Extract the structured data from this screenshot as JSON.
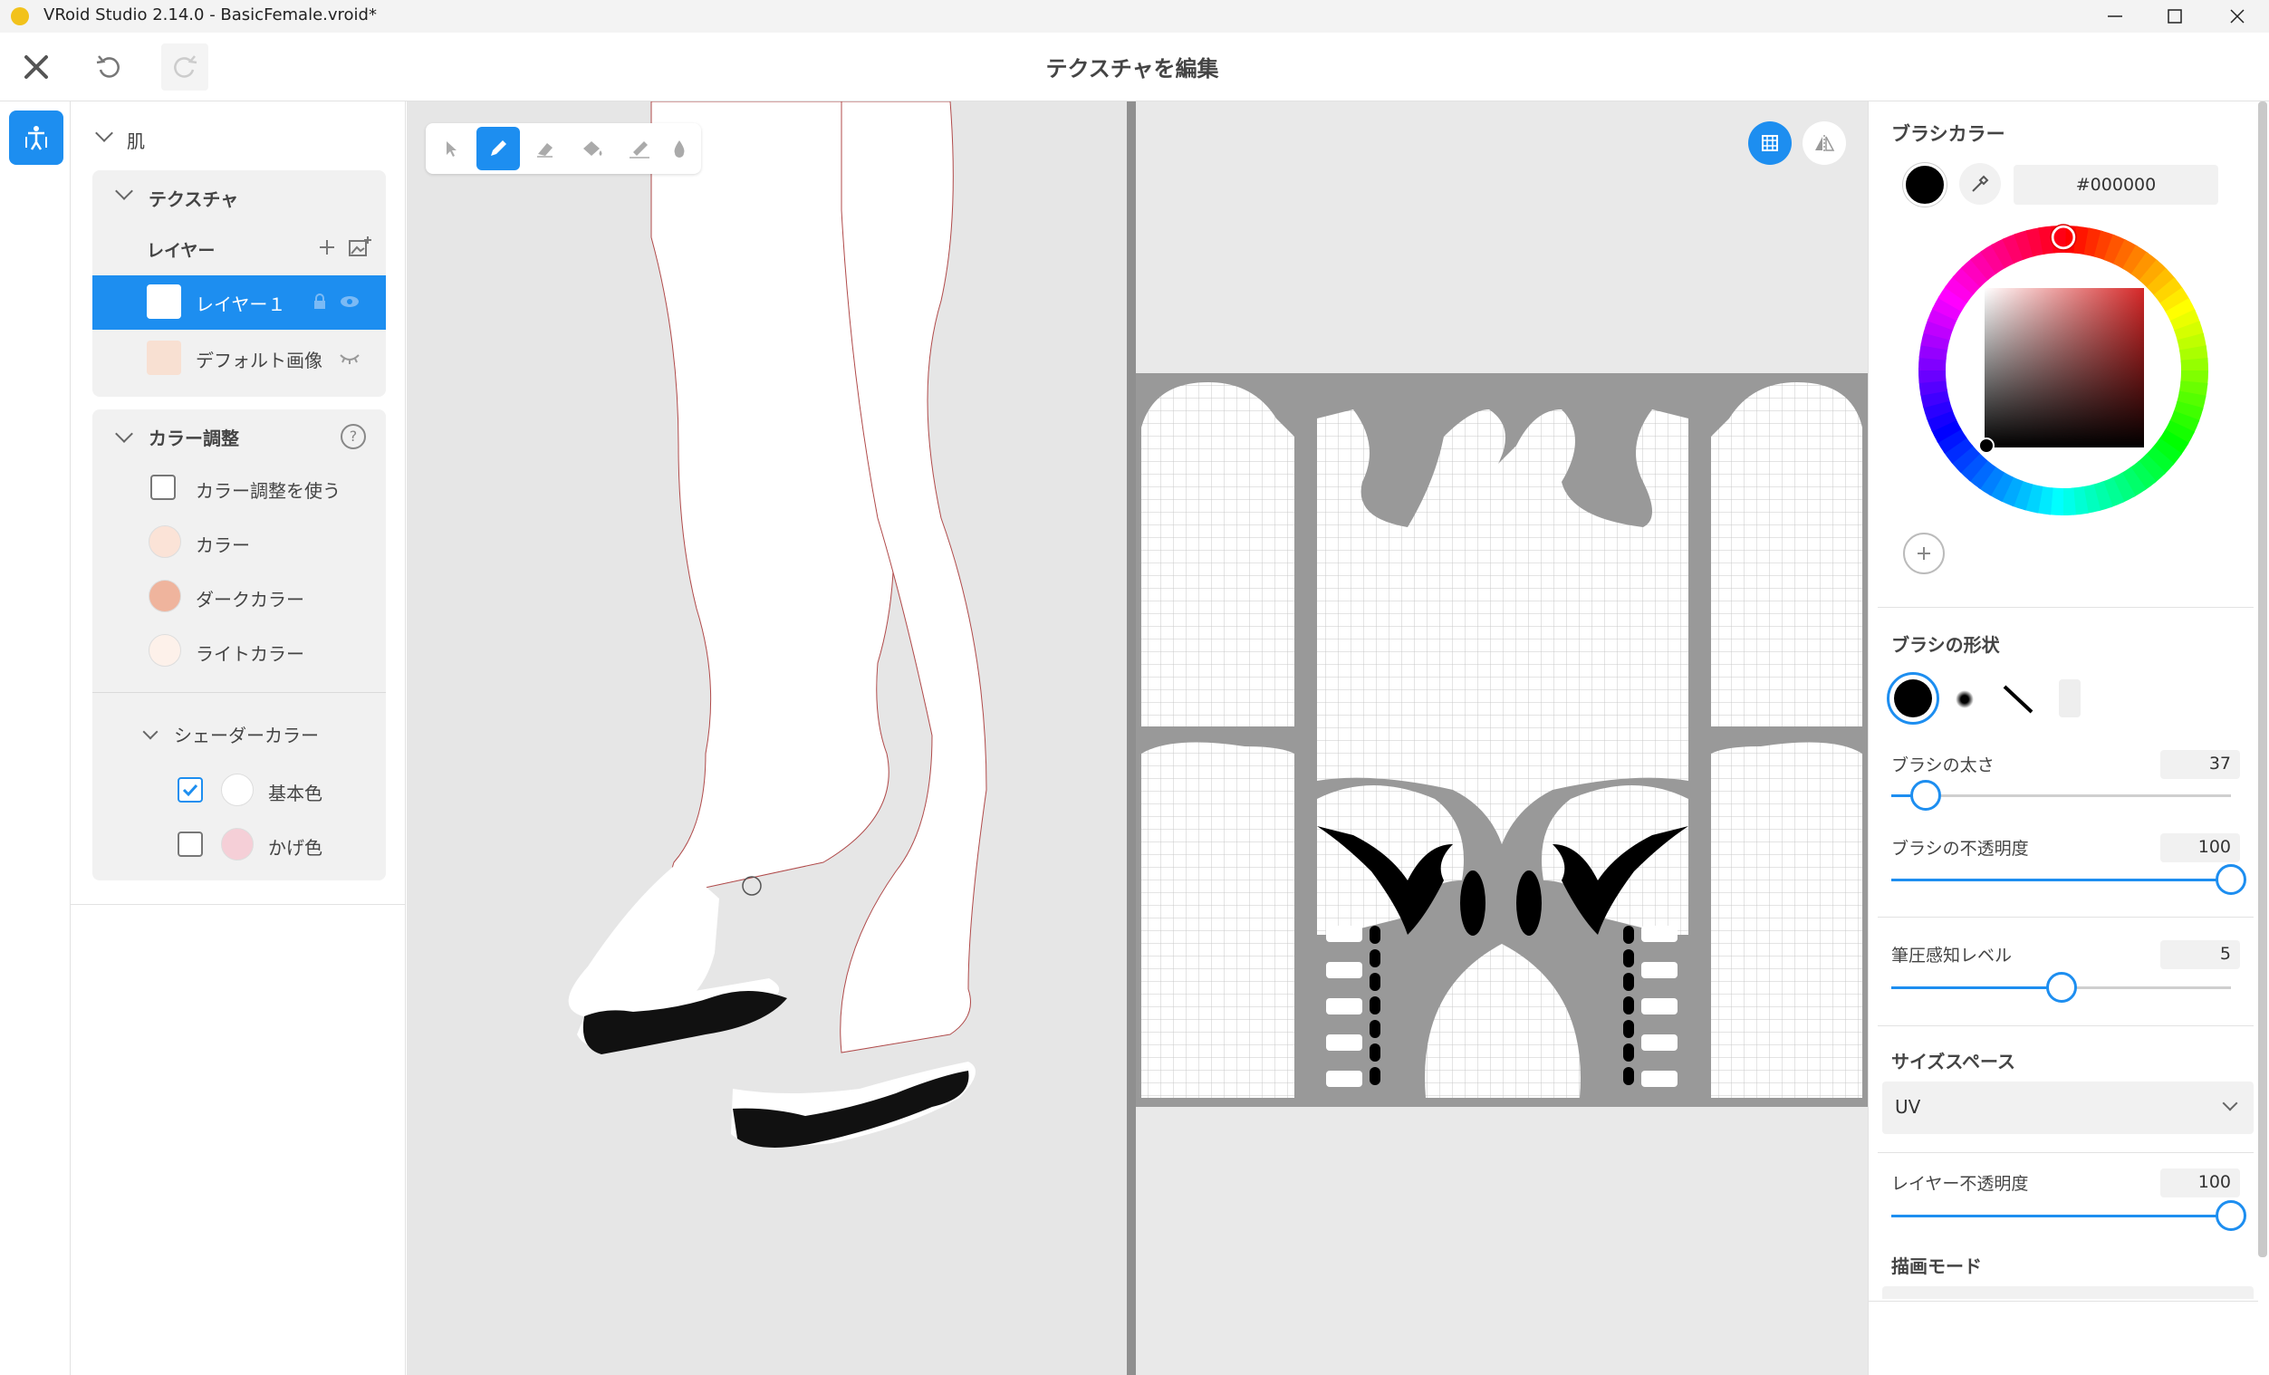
{
  "window": {
    "title": "VRoid Studio 2.14.0 - BasicFemale.vroid*"
  },
  "header": {
    "title": "テクスチャを編集"
  },
  "panel": {
    "category": "肌",
    "texture_section": "テクスチャ",
    "layers_label": "レイヤー",
    "layers": [
      {
        "name": "レイヤー１",
        "selected": true
      },
      {
        "name": "デフォルト画像",
        "selected": false
      }
    ],
    "color_adjust": {
      "title": "カラー調整",
      "use_label": "カラー調整を使う",
      "use_checked": false,
      "items": [
        {
          "label": "カラー",
          "color": "#fbe3d7"
        },
        {
          "label": "ダークカラー",
          "color": "#efb49d"
        },
        {
          "label": "ライトカラー",
          "color": "#fdf1ea"
        }
      ]
    },
    "shader_color": {
      "title": "シェーダーカラー",
      "items": [
        {
          "label": "基本色",
          "checked": true,
          "color": "#ffffff"
        },
        {
          "label": "かげ色",
          "checked": false,
          "color": "#f5cfd7"
        }
      ]
    }
  },
  "brush": {
    "color_title": "ブラシカラー",
    "hex": "#000000",
    "color": "#000000",
    "shape_title": "ブラシの形状",
    "size_label": "ブラシの太さ",
    "size_value": "37",
    "size_fraction": 0.1,
    "opacity_label": "ブラシの不透明度",
    "opacity_value": "100",
    "opacity_fraction": 1.0,
    "pressure_label": "筆圧感知レベル",
    "pressure_value": "5",
    "pressure_fraction": 0.5
  },
  "size_space": {
    "title": "サイズスペース",
    "value": "UV"
  },
  "layer_opacity": {
    "label": "レイヤー不透明度",
    "value": "100",
    "fraction": 1.0
  },
  "draw_mode": {
    "title": "描画モード"
  },
  "colors": {
    "accent": "#1d8ef0",
    "uv_gray": "#999999"
  }
}
